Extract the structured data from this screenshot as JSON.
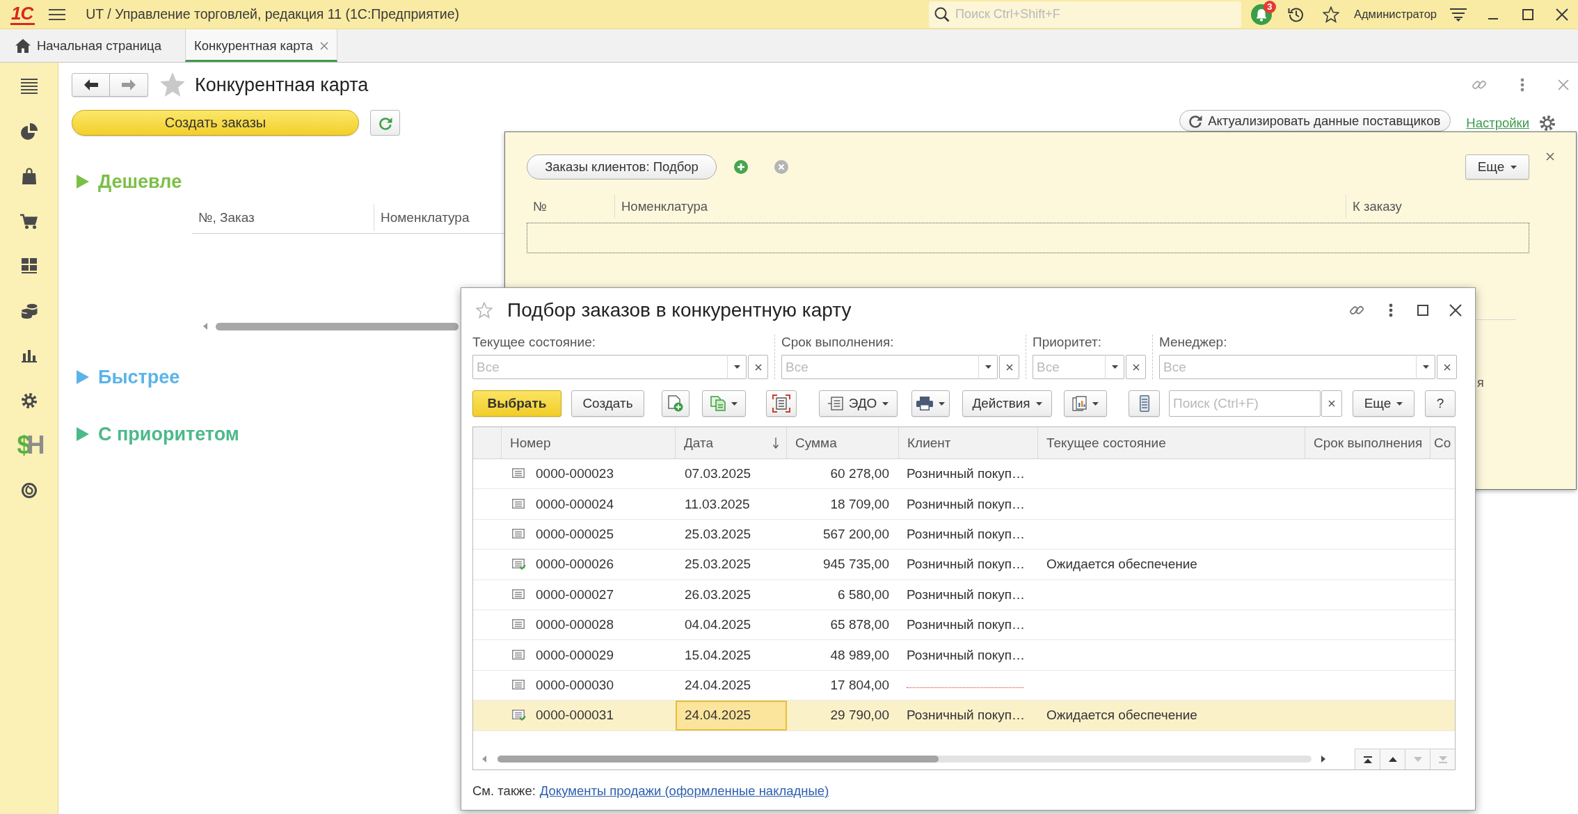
{
  "window": {
    "logo": "1С",
    "title": "UT / Управление торговлей, редакция 11 (1С:Предприятие)",
    "search": {
      "placeholder": "Поиск Ctrl+Shift+F"
    },
    "notification_count": "3",
    "user": "Администратор"
  },
  "tabs": [
    {
      "kind": "home",
      "label": "Начальная страница",
      "selected": false
    },
    {
      "kind": "page",
      "label": "Конкурентная карта",
      "selected": true
    }
  ],
  "sidebar": {
    "logo": [
      "$",
      "H"
    ]
  },
  "form": {
    "title": "Конкурентная карта",
    "create_button": "Создать заказы",
    "update_button": "Актуализировать данные поставщиков",
    "settings_link": "Настройки",
    "sections": [
      {
        "title": "Дешевле",
        "color": "#7cbf48",
        "columns": [
          "№, Заказ",
          "Номенклатура"
        ]
      },
      {
        "title": "Быстрее",
        "color": "#5ab4e8"
      },
      {
        "title": "С приоритетом",
        "color": "#4cb98a"
      }
    ]
  },
  "selection_panel": {
    "selection_button": "Заказы клиентов: Подбор",
    "more_button": "Еще",
    "columns": [
      "№",
      "Номенклатура",
      "К заказу"
    ],
    "text_fragment": "я"
  },
  "dialog": {
    "title": "Подбор заказов в конкурентную карту",
    "filters": [
      {
        "label": "Текущее состояние:",
        "placeholder": "Все"
      },
      {
        "label": "Срок выполнения:",
        "placeholder": "Все"
      },
      {
        "label": "Приоритет:",
        "placeholder": "Все"
      },
      {
        "label": "Менеджер:",
        "placeholder": "Все"
      }
    ],
    "toolbar": [
      {
        "kind": "primary",
        "label": "Выбрать"
      },
      {
        "kind": "button",
        "label": "Создать"
      },
      {
        "kind": "icon"
      },
      {
        "kind": "icon_menu"
      },
      {
        "kind": "icon"
      },
      {
        "kind": "icon_menu",
        "label": "ЭДО"
      },
      {
        "kind": "icon_menu"
      },
      {
        "kind": "menu",
        "label": "Действия"
      },
      {
        "kind": "icon_menu"
      },
      {
        "kind": "icon"
      },
      {
        "kind": "search",
        "placeholder": "Поиск (Ctrl+F)"
      },
      {
        "kind": "menu",
        "label": "Еще"
      },
      {
        "kind": "button",
        "label": "?"
      }
    ],
    "table": {
      "columns": [
        {
          "label": "Номер",
          "sorted": false
        },
        {
          "label": "Дата",
          "sorted": true
        },
        {
          "label": "Сумма",
          "sorted": false
        },
        {
          "label": "Клиент",
          "sorted": false
        },
        {
          "label": "Текущее состояние",
          "sorted": false
        },
        {
          "label": "Срок выполнения",
          "sorted": false
        },
        {
          "label": "Со",
          "sorted": false
        }
      ],
      "rows": [
        {
          "number": "0000-000023",
          "date": "07.03.2025",
          "amount": "60 278,00",
          "client": "Розничный покуп…",
          "posted": false,
          "selected": false,
          "current": false
        },
        {
          "number": "0000-000024",
          "date": "11.03.2025",
          "amount": "18 709,00",
          "client": "Розничный покуп…",
          "posted": false,
          "selected": false,
          "current": false
        },
        {
          "number": "0000-000025",
          "date": "25.03.2025",
          "amount": "567 200,00",
          "client": "Розничный покуп…",
          "posted": false,
          "selected": false,
          "current": false
        },
        {
          "number": "0000-000026",
          "date": "25.03.2025",
          "amount": "945 735,00",
          "client": "Розничный покуп…",
          "status": "Ожидается обеспечение",
          "posted": true,
          "selected": false,
          "current": false
        },
        {
          "number": "0000-000027",
          "date": "26.03.2025",
          "amount": "6 580,00",
          "client": "Розничный покуп…",
          "posted": false,
          "selected": false,
          "current": false
        },
        {
          "number": "0000-000028",
          "date": "04.04.2025",
          "amount": "65 878,00",
          "client": "Розничный покуп…",
          "posted": false,
          "selected": false,
          "current": false
        },
        {
          "number": "0000-000029",
          "date": "15.04.2025",
          "amount": "48 989,00",
          "client": "Розничный покуп…",
          "posted": false,
          "selected": false,
          "current": false
        },
        {
          "number": "0000-000030",
          "date": "24.04.2025",
          "amount": "17 804,00",
          "posted": false,
          "selected": false,
          "current": false
        },
        {
          "number": "0000-000031",
          "date": "24.04.2025",
          "amount": "29 790,00",
          "client": "Розничный покуп…",
          "status": "Ожидается обеспечение",
          "posted": true,
          "selected": true,
          "current": true
        }
      ],
      "nav_buttons": [
        {
          "kind": "first",
          "disabled": false
        },
        {
          "kind": "up",
          "disabled": false
        },
        {
          "kind": "down",
          "disabled": true
        },
        {
          "kind": "last",
          "disabled": true
        }
      ]
    },
    "footer": {
      "label": "См. также:",
      "link": "Документы продажи (оформленные накладные)"
    }
  }
}
